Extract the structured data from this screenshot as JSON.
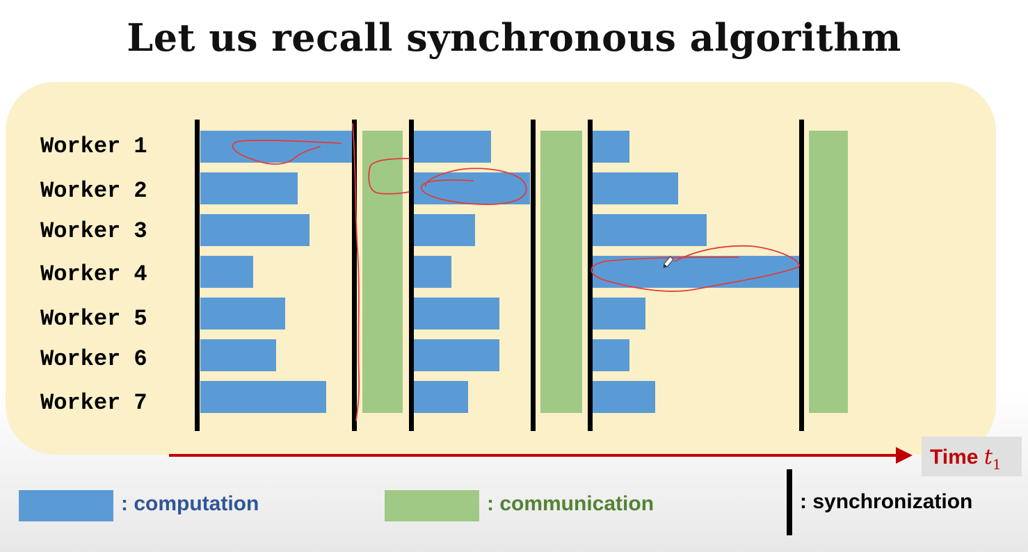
{
  "title": "Let us recall synchronous algorithm",
  "workers": [
    "Worker 1",
    "Worker 2",
    "Worker 3",
    "Worker 4",
    "Worker 5",
    "Worker 6",
    "Worker 7"
  ],
  "time_axis": {
    "label": "Time",
    "variable": "t",
    "subscript": "1"
  },
  "legend": {
    "computation": ": computation",
    "communication": ": communication",
    "synchronization": ": synchronization"
  },
  "colors": {
    "computation": "#5b9bd5",
    "communication": "#a0c986",
    "synchronization": "#000000",
    "time_axis": "#c00000",
    "annotation_ink": "#e03c3c",
    "panel_background": "#fbf0c8"
  },
  "annotations": "hand-drawn red circles around slowest worker in each round"
}
